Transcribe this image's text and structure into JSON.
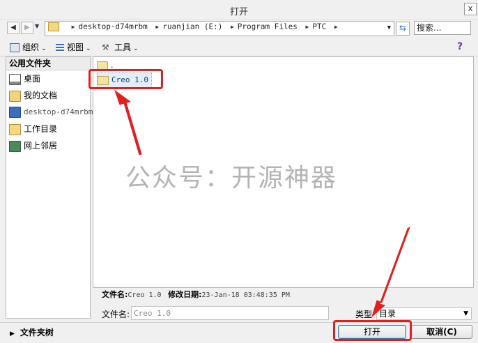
{
  "window": {
    "title": "打开",
    "close": "x"
  },
  "nav": {
    "back_icon": "arrow-left-icon",
    "forward_icon": "arrow-right-icon",
    "breadcrumbs": [
      "desktop-d74mrbm",
      "ruanjian (E:)",
      "Program Files",
      "PTC"
    ],
    "search_placeholder": "搜索..."
  },
  "toolbar": {
    "organize": "组织",
    "view": "视图",
    "tools": "工具"
  },
  "sidebar": {
    "header": "公用文件夹",
    "items": [
      {
        "label": "桌面",
        "icon": "desktop-icon"
      },
      {
        "label": "我的文档",
        "icon": "documents-icon"
      },
      {
        "label": "desktop-d74mrbm",
        "icon": "computer-icon"
      },
      {
        "label": "工作目录",
        "icon": "working-directory-icon"
      },
      {
        "label": "网上邻居",
        "icon": "network-icon"
      }
    ]
  },
  "files": [
    {
      "name": "."
    },
    {
      "name": "Creo 1.0",
      "selected": true
    }
  ],
  "watermark": "公众号：开源神器",
  "details": {
    "filename_label": "文件名:",
    "filename_value": "Creo 1.0",
    "modified_label": "修改日期:",
    "modified_value": "23-Jan-18 03:48:35 PM"
  },
  "form": {
    "filename_label": "文件名:",
    "filename_value": "Creo 1.0",
    "type_label": "类型",
    "type_value": "目录"
  },
  "bottom": {
    "folder_tree": "文件夹树",
    "open_button": "打开",
    "cancel_button": "取消(C)"
  },
  "colors": {
    "annotation": "#e02020",
    "folder": "#f5d77c"
  }
}
